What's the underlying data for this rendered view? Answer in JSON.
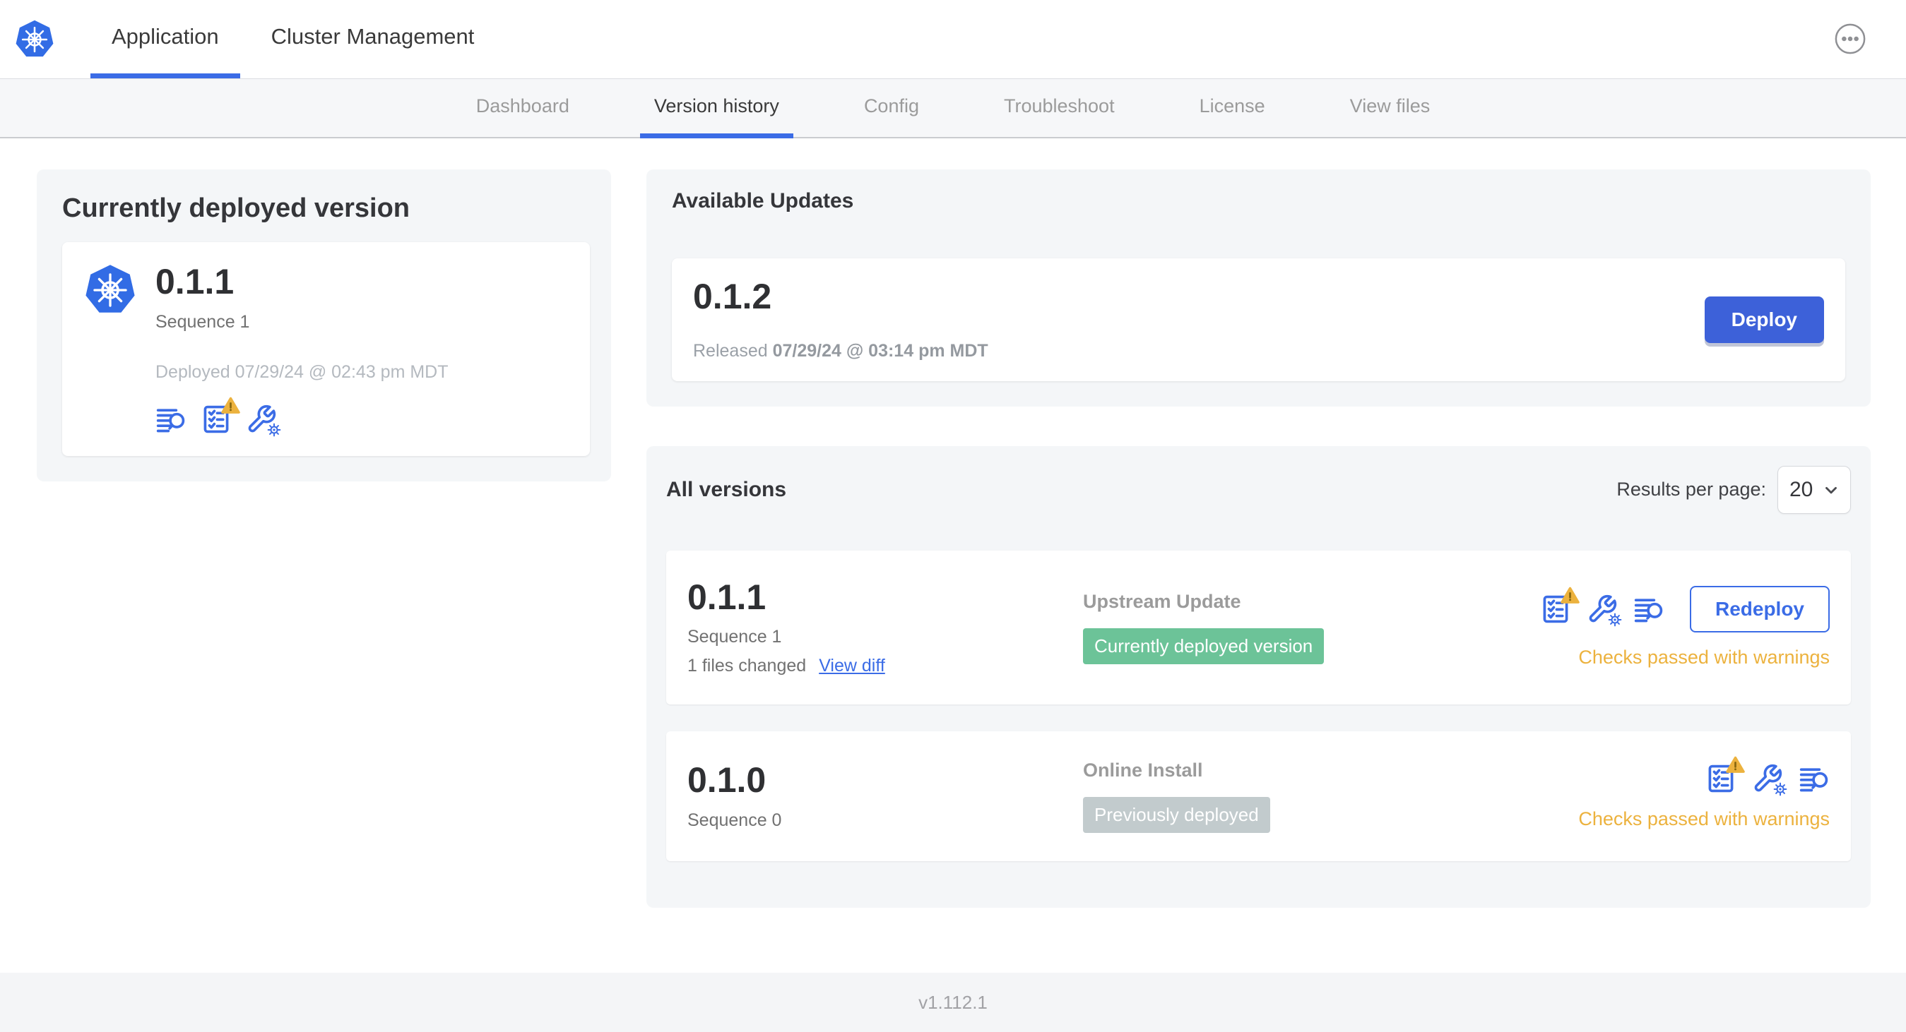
{
  "colors": {
    "accent": "#3b6ce6",
    "button": "#3d61d9",
    "warning": "#ecb23e",
    "badge_green": "#6cc398",
    "badge_gray": "#c2cbcd",
    "kubernetes_blue": "#326ce5"
  },
  "topnav": {
    "tabs": [
      {
        "label": "Application"
      },
      {
        "label": "Cluster Management"
      }
    ]
  },
  "subnav": {
    "tabs": [
      "Dashboard",
      "Version history",
      "Config",
      "Troubleshoot",
      "License",
      "View files"
    ],
    "active": "Version history"
  },
  "current_version": {
    "title": "Currently deployed version",
    "version": "0.1.1",
    "sequence": "Sequence 1",
    "deployed_at": "Deployed 07/29/24 @ 02:43 pm MDT"
  },
  "available_updates": {
    "title": "Available Updates",
    "version": "0.1.2",
    "released_prefix": "Released",
    "released_date": "07/29/24 @ 03:14 pm MDT",
    "deploy_label": "Deploy"
  },
  "all_versions": {
    "title": "All versions",
    "results_per_page_label": "Results per page:",
    "results_per_page_value": "20",
    "rows": [
      {
        "version": "0.1.1",
        "sequence": "Sequence 1",
        "files_changed": "1 files changed",
        "view_diff_label": "View diff",
        "source": "Upstream Update",
        "badge": "Currently deployed version",
        "badge_color": "#6cc398",
        "status": "Checks passed with warnings",
        "action_label": "Redeploy"
      },
      {
        "version": "0.1.0",
        "sequence": "Sequence 0",
        "source": "Online Install",
        "badge": "Previously deployed",
        "badge_color": "#c2cbcd",
        "status": "Checks passed with warnings"
      }
    ]
  },
  "footer": {
    "app_version": "v1.112.1"
  },
  "icons": {
    "kubernetes-logo": "blue heptagon with white ship wheel",
    "deploy-logs-icon": "text lines with magnifier",
    "preflight-checks-icon": "checklist clipboard",
    "warning-triangle-icon": "amber triangle with exclamation",
    "config-icon": "wrench with gear",
    "overflow-menu-icon": "circled ellipsis",
    "chevron-down-icon": "down chevron"
  }
}
